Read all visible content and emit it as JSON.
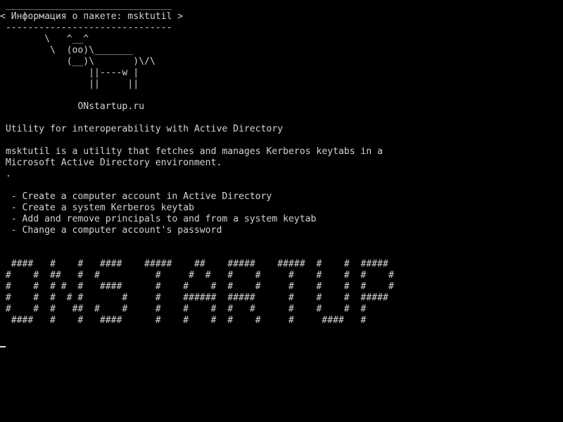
{
  "colors": {
    "background": "#000000",
    "foreground": "#d3d3d3"
  },
  "screen": {
    "lines": [
      " ______________________________",
      "< Информация о пакете: msktutil >",
      " ------------------------------",
      "        \\   ^__^",
      "         \\  (oo)\\_______",
      "            (__)\\       )\\/\\",
      "                ||----w |",
      "                ||     ||",
      "",
      "              ONstartup.ru",
      "",
      " Utility for interoperability with Active Directory",
      "",
      " msktutil is a utility that fetches and manages Kerberos keytabs in a",
      " Microsoft Active Directory environment.",
      " .",
      "",
      "  - Create a computer account in Active Directory",
      "  - Create a system Kerberos keytab",
      "  - Add and remove principals to and from a system keytab",
      "  - Change a computer account's password",
      "",
      "",
      "  ####   #    #   ####    #####    ##    #####    #####  #    #  #####",
      " #    #  ##   #  #          #     #  #   #    #     #    #    #  #    #",
      " #    #  # #  #   ####      #    #    #  #    #     #    #    #  #    #",
      " #    #  #  # #       #     #    ######  #####      #    #    #  #####",
      " #    #  #   ##  #    #     #    #    #  #   #      #    #    #  #",
      "  ####   #    #   ####      #    #    #  #    #     #     ####   #"
    ]
  }
}
